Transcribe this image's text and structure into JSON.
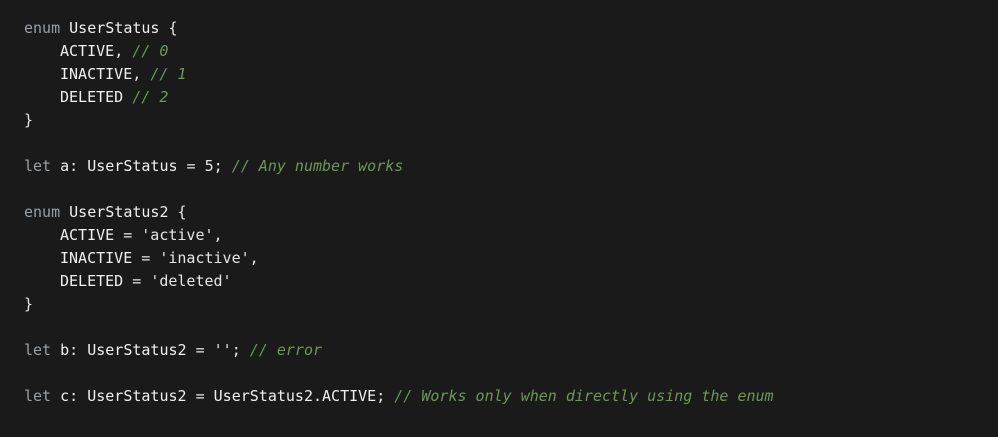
{
  "code": {
    "lines": [
      [
        {
          "t": "kw",
          "v": "enum"
        },
        {
          "t": "punct",
          "v": " "
        },
        {
          "t": "ident",
          "v": "UserStatus"
        },
        {
          "t": "punct",
          "v": " {"
        }
      ],
      [
        {
          "t": "indent",
          "v": ""
        },
        {
          "t": "ident",
          "v": "ACTIVE"
        },
        {
          "t": "punct",
          "v": ", "
        },
        {
          "t": "cmt",
          "v": "// 0"
        }
      ],
      [
        {
          "t": "indent",
          "v": ""
        },
        {
          "t": "ident",
          "v": "INACTIVE"
        },
        {
          "t": "punct",
          "v": ", "
        },
        {
          "t": "cmt",
          "v": "// 1"
        }
      ],
      [
        {
          "t": "indent",
          "v": ""
        },
        {
          "t": "ident",
          "v": "DELETED"
        },
        {
          "t": "punct",
          "v": " "
        },
        {
          "t": "cmt",
          "v": "// 2"
        }
      ],
      [
        {
          "t": "punct",
          "v": "}"
        }
      ],
      [],
      [
        {
          "t": "kw",
          "v": "let"
        },
        {
          "t": "punct",
          "v": " "
        },
        {
          "t": "ident",
          "v": "a"
        },
        {
          "t": "punct",
          "v": ": "
        },
        {
          "t": "ident",
          "v": "UserStatus"
        },
        {
          "t": "punct",
          "v": " = "
        },
        {
          "t": "num",
          "v": "5"
        },
        {
          "t": "punct",
          "v": "; "
        },
        {
          "t": "cmt",
          "v": "// Any number works"
        }
      ],
      [],
      [
        {
          "t": "kw",
          "v": "enum"
        },
        {
          "t": "punct",
          "v": " "
        },
        {
          "t": "ident",
          "v": "UserStatus2"
        },
        {
          "t": "punct",
          "v": " {"
        }
      ],
      [
        {
          "t": "indent",
          "v": ""
        },
        {
          "t": "ident",
          "v": "ACTIVE"
        },
        {
          "t": "punct",
          "v": " = "
        },
        {
          "t": "str",
          "v": "'active'"
        },
        {
          "t": "punct",
          "v": ","
        }
      ],
      [
        {
          "t": "indent",
          "v": ""
        },
        {
          "t": "ident",
          "v": "INACTIVE"
        },
        {
          "t": "punct",
          "v": " = "
        },
        {
          "t": "str",
          "v": "'inactive'"
        },
        {
          "t": "punct",
          "v": ","
        }
      ],
      [
        {
          "t": "indent",
          "v": ""
        },
        {
          "t": "ident",
          "v": "DELETED"
        },
        {
          "t": "punct",
          "v": " = "
        },
        {
          "t": "str",
          "v": "'deleted'"
        }
      ],
      [
        {
          "t": "punct",
          "v": "}"
        }
      ],
      [],
      [
        {
          "t": "kw",
          "v": "let"
        },
        {
          "t": "punct",
          "v": " "
        },
        {
          "t": "ident",
          "v": "b"
        },
        {
          "t": "punct",
          "v": ": "
        },
        {
          "t": "ident",
          "v": "UserStatus2"
        },
        {
          "t": "punct",
          "v": " = "
        },
        {
          "t": "str",
          "v": "''"
        },
        {
          "t": "punct",
          "v": "; "
        },
        {
          "t": "cmt",
          "v": "// error"
        }
      ],
      [],
      [
        {
          "t": "kw",
          "v": "let"
        },
        {
          "t": "punct",
          "v": " "
        },
        {
          "t": "ident",
          "v": "c"
        },
        {
          "t": "punct",
          "v": ": "
        },
        {
          "t": "ident",
          "v": "UserStatus2"
        },
        {
          "t": "punct",
          "v": " = "
        },
        {
          "t": "ident",
          "v": "UserStatus2.ACTIVE"
        },
        {
          "t": "punct",
          "v": "; "
        },
        {
          "t": "cmt",
          "v": "// Works only when directly using the enum"
        }
      ]
    ]
  },
  "colors": {
    "background": "#1a1a1a",
    "comment": "#6a9955",
    "keyword": "#9aa0a6",
    "text": "#e6e6e6"
  }
}
